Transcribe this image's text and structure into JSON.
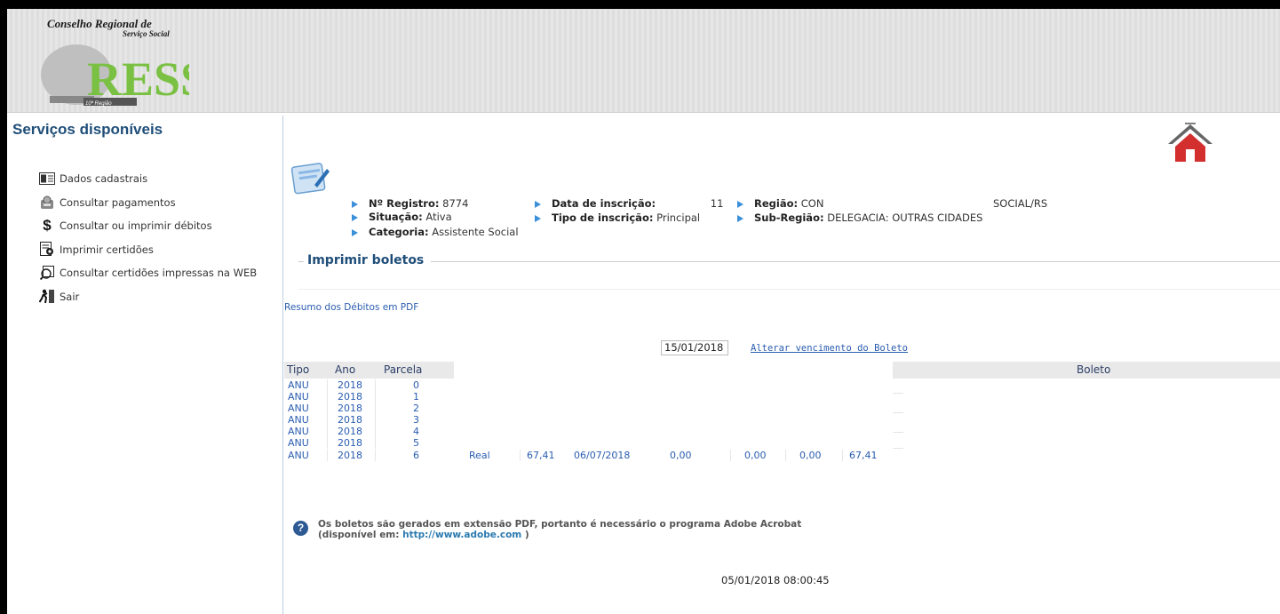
{
  "header": {
    "strip_text": "",
    "logo": {
      "line1": "Conselho Regional de",
      "line2": "Serviço Social",
      "brand": "RESS",
      "region": "10ª Região"
    }
  },
  "sidebar": {
    "title": "Serviços disponíveis",
    "items": [
      {
        "label": "Dados cadastrais",
        "icon": "id-card-icon"
      },
      {
        "label": "Consultar pagamentos",
        "icon": "payment-icon"
      },
      {
        "label": "Consultar ou imprimir débitos",
        "icon": "dollar-icon"
      },
      {
        "label": "Imprimir certidões",
        "icon": "certificate-icon"
      },
      {
        "label": "Consultar certidões impressas na WEB",
        "icon": "web-certificate-icon"
      },
      {
        "label": "Sair",
        "icon": "exit-icon"
      }
    ]
  },
  "profile": {
    "registro_label": "Nº Registro:",
    "registro_value": "8774",
    "situacao_label": "Situação:",
    "situacao_value": "Ativa",
    "categoria_label": "Categoria:",
    "categoria_value": "Assistente Social",
    "data_label": "Data de inscrição:",
    "data_value": "11",
    "tipo_label": "Tipo de inscrição:",
    "tipo_value": "Principal",
    "regiao_label": "Região:",
    "regiao_value": "CON",
    "regiao_tail": "SOCIAL/RS",
    "subregiao_label": "Sub-Região:",
    "subregiao_value": "DELEGACIA: OUTRAS CIDADES"
  },
  "section": {
    "title": "Imprimir boletos",
    "pdf_link": "Resumo dos Débitos em PDF",
    "due_date": "15/01/2018",
    "alter_link": "Alterar vencimento do Boleto"
  },
  "table": {
    "headers": {
      "tipo": "Tipo",
      "ano": "Ano",
      "parcela": "Parcela",
      "boleto": "Boleto"
    },
    "rows": [
      {
        "tipo": "ANU",
        "ano": "2018",
        "parcela": "0"
      },
      {
        "tipo": "ANU",
        "ano": "2018",
        "parcela": "1"
      },
      {
        "tipo": "ANU",
        "ano": "2018",
        "parcela": "2"
      },
      {
        "tipo": "ANU",
        "ano": "2018",
        "parcela": "3"
      },
      {
        "tipo": "ANU",
        "ano": "2018",
        "parcela": "4"
      },
      {
        "tipo": "ANU",
        "ano": "2018",
        "parcela": "5"
      },
      {
        "tipo": "ANU",
        "ano": "2018",
        "parcela": "6",
        "moeda": "Real",
        "valor": "67,41",
        "vencimento": "06/07/2018",
        "c1": "0,00",
        "c2": "0,00",
        "c3": "0,00",
        "total": "67,41"
      }
    ]
  },
  "help": {
    "line1": "Os boletos são gerados em extensão PDF, portanto é necessário o programa Adobe Acrobat",
    "line2_prefix": "(disponível em:",
    "link": "http://www.adobe.com",
    "line2_suffix": ")"
  },
  "timestamp": "05/01/2018 08:00:45"
}
